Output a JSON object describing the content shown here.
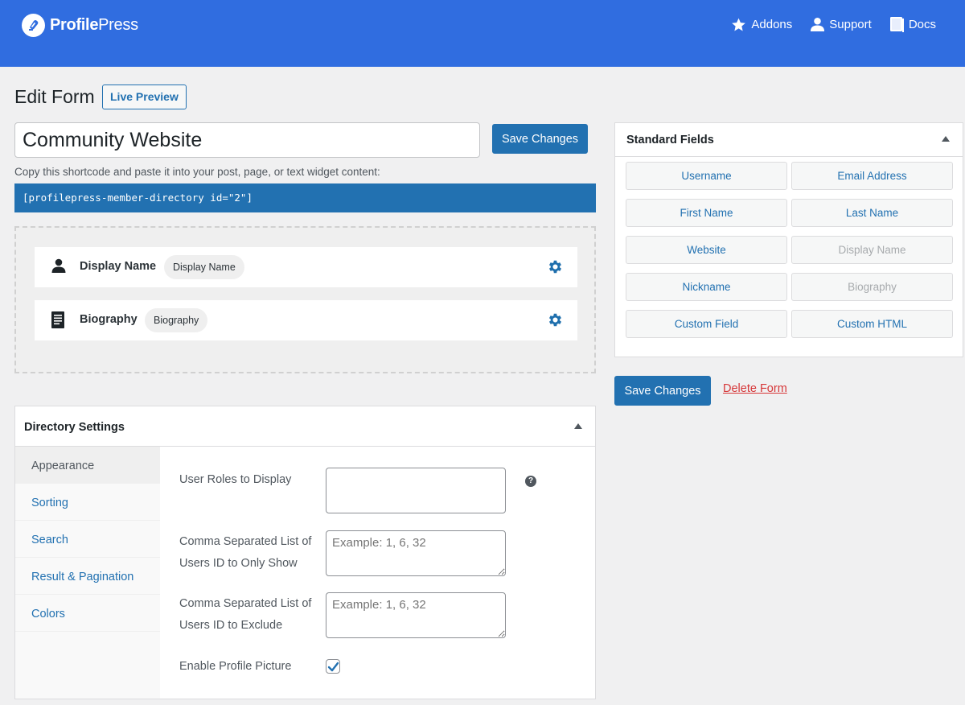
{
  "header": {
    "brand_bold": "Profile",
    "brand_regular": "Press",
    "nav": [
      {
        "label": "Addons",
        "icon": "star-icon"
      },
      {
        "label": "Support",
        "icon": "user-icon"
      },
      {
        "label": "Docs",
        "icon": "book-icon"
      }
    ]
  },
  "page": {
    "title": "Edit Form",
    "live_preview_label": "Live Preview",
    "form_name": "Community Website",
    "save_label": "Save Changes",
    "shortcode_help": "Copy this shortcode and paste it into your post, page, or text widget content:",
    "shortcode": "[profilepress-member-directory id=\"2\"]"
  },
  "builder": {
    "fields": [
      {
        "label": "Display Name",
        "tag": "Display Name",
        "icon": "user-icon"
      },
      {
        "label": "Biography",
        "tag": "Biography",
        "icon": "document-icon"
      }
    ]
  },
  "standard_fields": {
    "title": "Standard Fields",
    "buttons": [
      {
        "label": "Username",
        "enabled": true
      },
      {
        "label": "Email Address",
        "enabled": true
      },
      {
        "label": "First Name",
        "enabled": true
      },
      {
        "label": "Last Name",
        "enabled": true
      },
      {
        "label": "Website",
        "enabled": true
      },
      {
        "label": "Display Name",
        "enabled": false
      },
      {
        "label": "Nickname",
        "enabled": true
      },
      {
        "label": "Biography",
        "enabled": false
      },
      {
        "label": "Custom Field",
        "enabled": true
      },
      {
        "label": "Custom HTML",
        "enabled": true
      }
    ],
    "save_label": "Save Changes",
    "delete_label": "Delete Form"
  },
  "directory_settings": {
    "title": "Directory Settings",
    "tabs": [
      {
        "label": "Appearance",
        "active": true
      },
      {
        "label": "Sorting",
        "active": false
      },
      {
        "label": "Search",
        "active": false
      },
      {
        "label": "Result & Pagination",
        "active": false
      },
      {
        "label": "Colors",
        "active": false
      }
    ],
    "settings": {
      "user_roles_label": "User Roles to Display",
      "user_roles_value": "",
      "only_show_label_1": "Comma Separated List of",
      "only_show_label_2": "Users ID to Only Show",
      "only_show_placeholder": "Example: 1, 6, 32",
      "exclude_label_1": "Comma Separated List of",
      "exclude_label_2": "Users ID to Exclude",
      "exclude_placeholder": "Example: 1, 6, 32",
      "profile_picture_label": "Enable Profile Picture",
      "profile_picture_checked": true,
      "help_glyph": "?"
    }
  },
  "colors": {
    "header_bg": "#306de0",
    "primary": "#2271b1",
    "danger": "#d63638"
  }
}
